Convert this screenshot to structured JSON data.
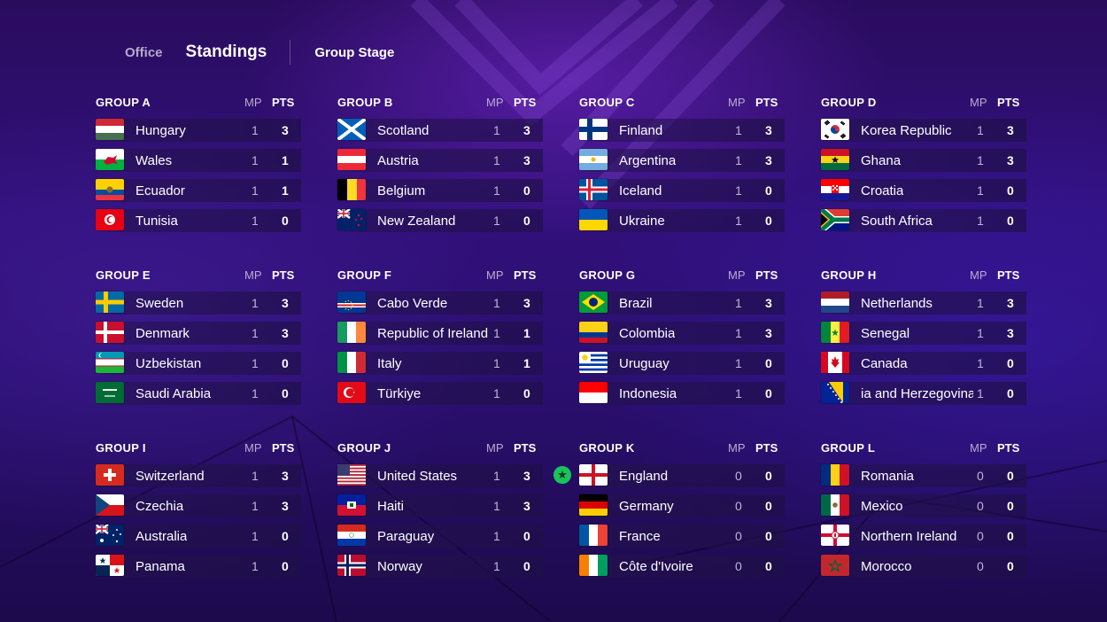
{
  "nav": {
    "office": "Office",
    "standings": "Standings",
    "stage": "Group Stage"
  },
  "headers": {
    "mp": "MP",
    "pts": "PTS"
  },
  "groups": [
    {
      "name": "GROUP A",
      "teams": [
        {
          "name": "Hungary",
          "flag": "hungary",
          "mp": "1",
          "pts": "3"
        },
        {
          "name": "Wales",
          "flag": "wales",
          "mp": "1",
          "pts": "1"
        },
        {
          "name": "Ecuador",
          "flag": "ecuador",
          "mp": "1",
          "pts": "1"
        },
        {
          "name": "Tunisia",
          "flag": "tunisia",
          "mp": "1",
          "pts": "0"
        }
      ]
    },
    {
      "name": "GROUP B",
      "teams": [
        {
          "name": "Scotland",
          "flag": "scotland",
          "mp": "1",
          "pts": "3"
        },
        {
          "name": "Austria",
          "flag": "austria",
          "mp": "1",
          "pts": "3"
        },
        {
          "name": "Belgium",
          "flag": "belgium",
          "mp": "1",
          "pts": "0"
        },
        {
          "name": "New Zealand",
          "flag": "newzealand",
          "mp": "1",
          "pts": "0"
        }
      ]
    },
    {
      "name": "GROUP C",
      "teams": [
        {
          "name": "Finland",
          "flag": "finland",
          "mp": "1",
          "pts": "3"
        },
        {
          "name": "Argentina",
          "flag": "argentina",
          "mp": "1",
          "pts": "3"
        },
        {
          "name": "Iceland",
          "flag": "iceland",
          "mp": "1",
          "pts": "0"
        },
        {
          "name": "Ukraine",
          "flag": "ukraine",
          "mp": "1",
          "pts": "0"
        }
      ]
    },
    {
      "name": "GROUP D",
      "teams": [
        {
          "name": "Korea Republic",
          "flag": "korea",
          "mp": "1",
          "pts": "3"
        },
        {
          "name": "Ghana",
          "flag": "ghana",
          "mp": "1",
          "pts": "3"
        },
        {
          "name": "Croatia",
          "flag": "croatia",
          "mp": "1",
          "pts": "0"
        },
        {
          "name": "South Africa",
          "flag": "southafrica",
          "mp": "1",
          "pts": "0"
        }
      ]
    },
    {
      "name": "GROUP E",
      "teams": [
        {
          "name": "Sweden",
          "flag": "sweden",
          "mp": "1",
          "pts": "3"
        },
        {
          "name": "Denmark",
          "flag": "denmark",
          "mp": "1",
          "pts": "3"
        },
        {
          "name": "Uzbekistan",
          "flag": "uzbekistan",
          "mp": "1",
          "pts": "0"
        },
        {
          "name": "Saudi Arabia",
          "flag": "saudiarabia",
          "mp": "1",
          "pts": "0"
        }
      ]
    },
    {
      "name": "GROUP F",
      "teams": [
        {
          "name": "Cabo Verde",
          "flag": "caboverde",
          "mp": "1",
          "pts": "3"
        },
        {
          "name": "Republic of Ireland",
          "flag": "ireland",
          "mp": "1",
          "pts": "1"
        },
        {
          "name": "Italy",
          "flag": "italy",
          "mp": "1",
          "pts": "1"
        },
        {
          "name": "Türkiye",
          "flag": "turkiye",
          "mp": "1",
          "pts": "0"
        }
      ]
    },
    {
      "name": "GROUP G",
      "teams": [
        {
          "name": "Brazil",
          "flag": "brazil",
          "mp": "1",
          "pts": "3"
        },
        {
          "name": "Colombia",
          "flag": "colombia",
          "mp": "1",
          "pts": "3"
        },
        {
          "name": "Uruguay",
          "flag": "uruguay",
          "mp": "1",
          "pts": "0"
        },
        {
          "name": "Indonesia",
          "flag": "indonesia",
          "mp": "1",
          "pts": "0"
        }
      ]
    },
    {
      "name": "GROUP H",
      "teams": [
        {
          "name": "Netherlands",
          "flag": "netherlands",
          "mp": "1",
          "pts": "3"
        },
        {
          "name": "Senegal",
          "flag": "senegal",
          "mp": "1",
          "pts": "3"
        },
        {
          "name": "Canada",
          "flag": "canada",
          "mp": "1",
          "pts": "0"
        },
        {
          "name": "ia and Herzegovina",
          "flag": "bosnia",
          "mp": "1",
          "pts": "0"
        }
      ]
    },
    {
      "name": "GROUP I",
      "teams": [
        {
          "name": "Switzerland",
          "flag": "switzerland",
          "mp": "1",
          "pts": "3"
        },
        {
          "name": "Czechia",
          "flag": "czechia",
          "mp": "1",
          "pts": "3"
        },
        {
          "name": "Australia",
          "flag": "australia",
          "mp": "1",
          "pts": "0"
        },
        {
          "name": "Panama",
          "flag": "panama",
          "mp": "1",
          "pts": "0"
        }
      ]
    },
    {
      "name": "GROUP J",
      "teams": [
        {
          "name": "United States",
          "flag": "usa",
          "mp": "1",
          "pts": "3"
        },
        {
          "name": "Haiti",
          "flag": "haiti",
          "mp": "1",
          "pts": "3"
        },
        {
          "name": "Paraguay",
          "flag": "paraguay",
          "mp": "1",
          "pts": "0"
        },
        {
          "name": "Norway",
          "flag": "norway",
          "mp": "1",
          "pts": "0"
        }
      ]
    },
    {
      "name": "GROUP K",
      "teams": [
        {
          "name": "England",
          "flag": "england",
          "mp": "0",
          "pts": "0",
          "marker": "star-icon"
        },
        {
          "name": "Germany",
          "flag": "germany",
          "mp": "0",
          "pts": "0"
        },
        {
          "name": "France",
          "flag": "france",
          "mp": "0",
          "pts": "0"
        },
        {
          "name": "Côte d'Ivoire",
          "flag": "ivorycoast",
          "mp": "0",
          "pts": "0"
        }
      ]
    },
    {
      "name": "GROUP L",
      "teams": [
        {
          "name": "Romania",
          "flag": "romania",
          "mp": "0",
          "pts": "0"
        },
        {
          "name": "Mexico",
          "flag": "mexico",
          "mp": "0",
          "pts": "0"
        },
        {
          "name": "Northern Ireland",
          "flag": "northernireland",
          "mp": "0",
          "pts": "0"
        },
        {
          "name": "Morocco",
          "flag": "morocco",
          "mp": "0",
          "pts": "0"
        }
      ]
    }
  ],
  "colors": {
    "background": "#2b0f70",
    "marker": "#19c35a"
  }
}
